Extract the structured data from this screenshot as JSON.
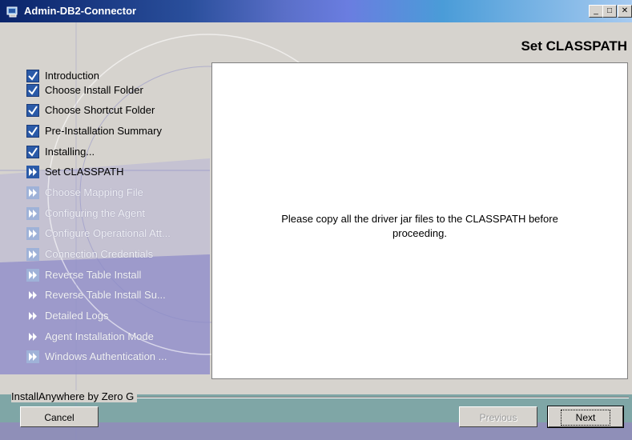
{
  "window": {
    "title": "Admin-DB2-Connector",
    "minimize": "_",
    "maximize": "□",
    "close": "✕"
  },
  "header": {
    "title": "Set CLASSPATH"
  },
  "steps": [
    {
      "label": "Introduction",
      "state": "done"
    },
    {
      "label": "Choose Install Folder",
      "state": "done"
    },
    {
      "label": "Choose Shortcut Folder",
      "state": "done"
    },
    {
      "label": "Pre-Installation Summary",
      "state": "done"
    },
    {
      "label": "Installing...",
      "state": "done"
    },
    {
      "label": "Set CLASSPATH",
      "state": "current"
    },
    {
      "label": "Choose Mapping File",
      "state": "todo"
    },
    {
      "label": "Configuring the Agent",
      "state": "todo"
    },
    {
      "label": "Configure Operational Att...",
      "state": "todo"
    },
    {
      "label": "Connection Credentials",
      "state": "todo"
    },
    {
      "label": "Reverse Table Install",
      "state": "todo"
    },
    {
      "label": "Reverse Table Install Su...",
      "state": "todo"
    },
    {
      "label": "Detailed Logs",
      "state": "todo"
    },
    {
      "label": "Agent Installation Mode",
      "state": "todo"
    },
    {
      "label": "Windows Authentication ...",
      "state": "todo"
    }
  ],
  "content": {
    "message_line1": "Please copy all the driver jar files to the CLASSPATH before",
    "message_line2": "proceeding."
  },
  "footer": {
    "brand": "InstallAnywhere by Zero G",
    "cancel": "Cancel",
    "previous": "Previous",
    "next": "Next"
  },
  "colors": {
    "accent": "#2a5aa8",
    "window_bg": "#d6d3ce",
    "panel_bg": "#ffffff"
  }
}
